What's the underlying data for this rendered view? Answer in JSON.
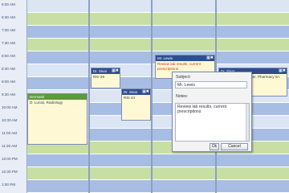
{
  "time_labels": [
    "6:00 AM",
    "6:30 AM",
    "7:00 AM",
    "7:30 AM",
    "8:00 AM",
    "8:30 AM",
    "9:00 AM",
    "9:30 AM",
    "10:00 AM",
    "10:30 AM",
    "11:00 AM",
    "11:30 AM",
    "12:00 PM",
    "12:30 PM",
    "1:00 PM"
  ],
  "appointments": [
    {
      "header": "Dermatol",
      "body": "D. Lucas, Radiology"
    },
    {
      "header": "Dr. Sivar",
      "body": "RKI 28"
    },
    {
      "header": "Dr. Sivar",
      "body": "RSI 44"
    },
    {
      "header": "Mr. Lewis",
      "body": "Review lab results, current prescriptions"
    },
    {
      "header": "Dr. Sivar",
      "body": "Review lab sn. Rager, Pharmacy sn. Rager, Pharmacy"
    }
  ],
  "editor": {
    "subject_label": "Subject:",
    "subject_value": "Mr. Lewis",
    "notes_label": "Notes:",
    "notes_value": "Review lab results, current prescriptions",
    "ok_label": "Ok",
    "cancel_label": "Cancel"
  },
  "colors": {
    "header_blue": "#2f4d8f",
    "appointment_fill": "#fff8d4",
    "slot_green": "#c8dfa4",
    "slot_blue": "#a7bde3"
  },
  "icons": {
    "edit": "edit-icon",
    "close": "close-icon"
  }
}
